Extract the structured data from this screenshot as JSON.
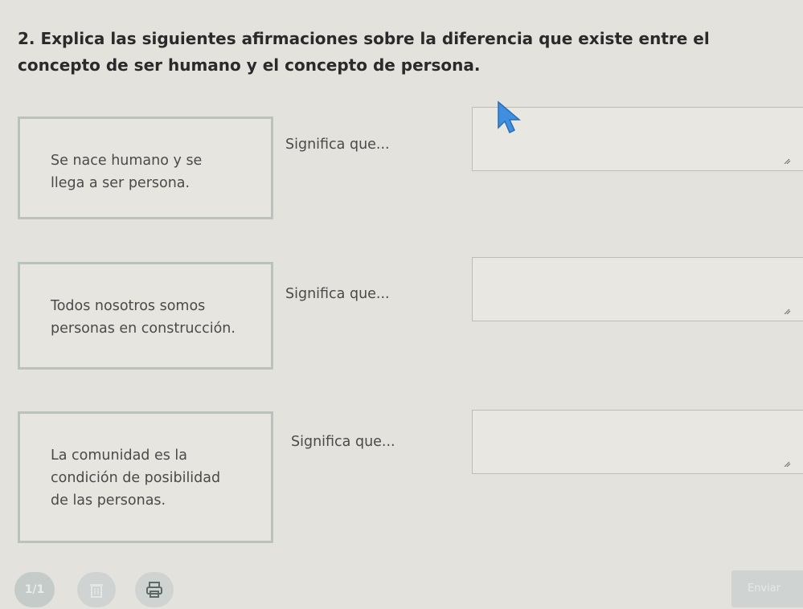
{
  "question": {
    "text": "2. Explica las siguientes afirmaciones sobre la diferencia que existe entre el concepto de ser humano y el concepto de persona."
  },
  "items": [
    {
      "statement": "Se nace humano y se\nllega a ser persona.",
      "prompt": "Significa que...",
      "answer": ""
    },
    {
      "statement": "Todos nosotros somos\npersonas en construcción.",
      "prompt": "Significa que...",
      "answer": ""
    },
    {
      "statement": "La comunidad es la\ncondición de posibilidad\nde las personas.",
      "prompt": "Significa que...",
      "answer": ""
    }
  ],
  "toolbar": {
    "page_indicator": "1/1",
    "send_label": "Enviar"
  },
  "icons": {
    "delete": "trash-icon",
    "print": "printer-icon",
    "resize": "resize-handle-icon",
    "cursor": "mouse-pointer-icon"
  }
}
